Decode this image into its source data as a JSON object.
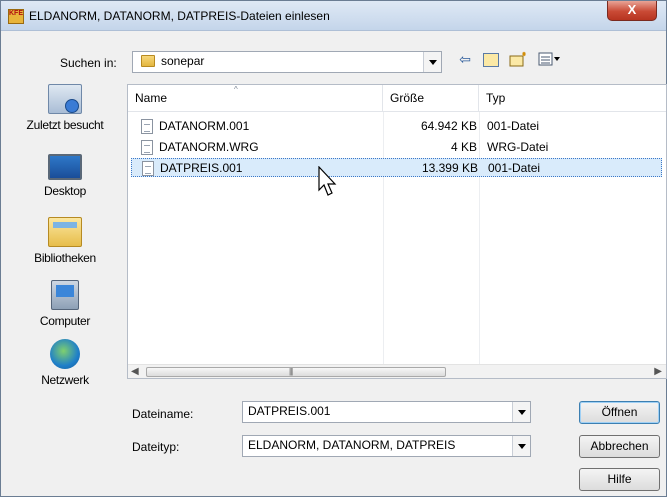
{
  "window": {
    "title": "ELDANORM, DATANORM, DATPREIS-Dateien einlesen",
    "close_label": "X"
  },
  "toolbar": {
    "look_in_label": "Suchen in:",
    "look_in_value": "sonepar",
    "icons": [
      "back-icon",
      "up-folder-icon",
      "new-folder-icon",
      "views-menu-icon"
    ]
  },
  "places": [
    {
      "label": "Zuletzt besucht",
      "icon": "recent-places-icon"
    },
    {
      "label": "Desktop",
      "icon": "desktop-icon"
    },
    {
      "label": "Bibliotheken",
      "icon": "libraries-icon"
    },
    {
      "label": "Computer",
      "icon": "computer-icon"
    },
    {
      "label": "Netzwerk",
      "icon": "network-icon"
    }
  ],
  "filelist": {
    "columns": [
      "Name",
      "Größe",
      "Typ"
    ],
    "rows": [
      {
        "name": "DATANORM.001",
        "size": "64.942 KB",
        "type": "001-Datei",
        "selected": false
      },
      {
        "name": "DATANORM.WRG",
        "size": "4 KB",
        "type": "WRG-Datei",
        "selected": false
      },
      {
        "name": "DATPREIS.001",
        "size": "13.399 KB",
        "type": "001-Datei",
        "selected": true
      }
    ]
  },
  "form": {
    "filename_label": "Dateiname:",
    "filename_value": "DATPREIS.001",
    "filetype_label": "Dateityp:",
    "filetype_value": "ELDANORM, DATANORM, DATPREIS"
  },
  "buttons": {
    "open": "Öffnen",
    "cancel": "Abbrechen",
    "help": "Hilfe"
  },
  "colors": {
    "selection": "#d9ebfb",
    "title_bar": "#c4d5ea",
    "close_button": "#c94a35"
  }
}
